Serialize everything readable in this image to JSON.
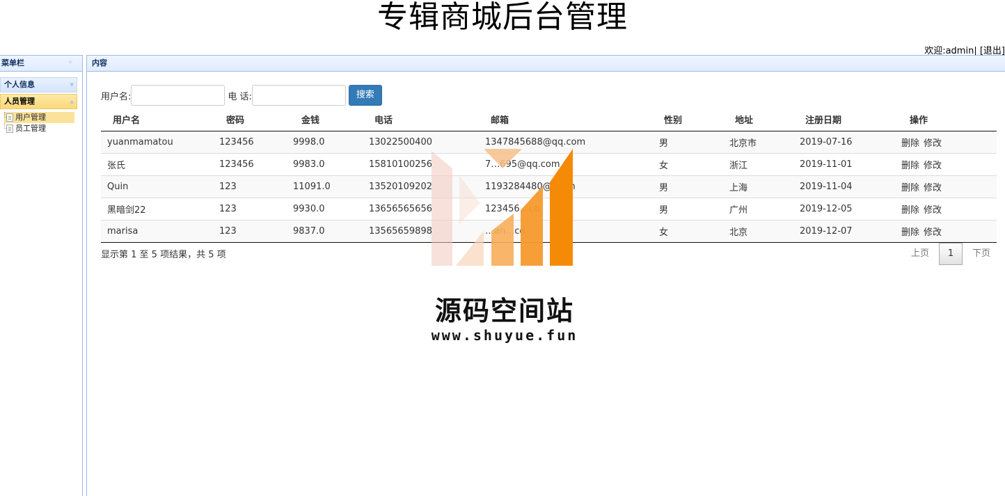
{
  "header": {
    "title": "专辑商城后台管理",
    "welcome_prefix": "欢迎:",
    "username": "admin",
    "separator": "|",
    "logout_label": "[退出]"
  },
  "menu": {
    "title": "菜单栏",
    "groups": [
      {
        "label": "个人信息",
        "expanded": false
      },
      {
        "label": "人员管理",
        "expanded": true
      }
    ],
    "tree_items": [
      {
        "label": "用户管理",
        "selected": true
      },
      {
        "label": "员工管理",
        "selected": false
      }
    ]
  },
  "content": {
    "title": "内容",
    "search": {
      "username_label": "用户名:",
      "phone_label": "电 话:",
      "username_value": "",
      "phone_value": "",
      "button_label": "搜索"
    },
    "table": {
      "columns": [
        "用户名",
        "密码",
        "金钱",
        "电话",
        "邮箱",
        "性别",
        "地址",
        "注册日期",
        "操作"
      ],
      "rows": [
        [
          "yuanmamatou",
          "123456",
          "9998.0",
          "13022500400",
          "1347845688@qq.com",
          "男",
          "北京市",
          "2019-07-16"
        ],
        [
          "张氏",
          "123456",
          "9983.0",
          "15810100256",
          "7…695@qq.com",
          "女",
          "浙江",
          "2019-11-01"
        ],
        [
          "Quin",
          "123",
          "11091.0",
          "13520109202",
          "1193284480@q…m",
          "男",
          "上海",
          "2019-11-04"
        ],
        [
          "黑暗剑22",
          "123",
          "9930.0",
          "13656565656",
          "123456…co",
          "男",
          "广州",
          "2019-12-05"
        ],
        [
          "marisa",
          "123",
          "9837.0",
          "13565659898",
          "…an…co",
          "女",
          "北京",
          "2019-12-07"
        ]
      ],
      "actions": [
        "删除",
        "修改"
      ]
    },
    "footer_info": "显示第 1 至 5 项结果，共 5 项",
    "pager": {
      "prev": "上页",
      "current": "1",
      "next": "下页"
    }
  },
  "watermark": {
    "name": "源码空间站",
    "url": "www.shuyue.fun"
  },
  "colors": {
    "panel_border": "#99bbe8",
    "selected_bg": "#fbe29b",
    "search_button": "#337ab7",
    "watermark_orange": "#f58a07"
  }
}
